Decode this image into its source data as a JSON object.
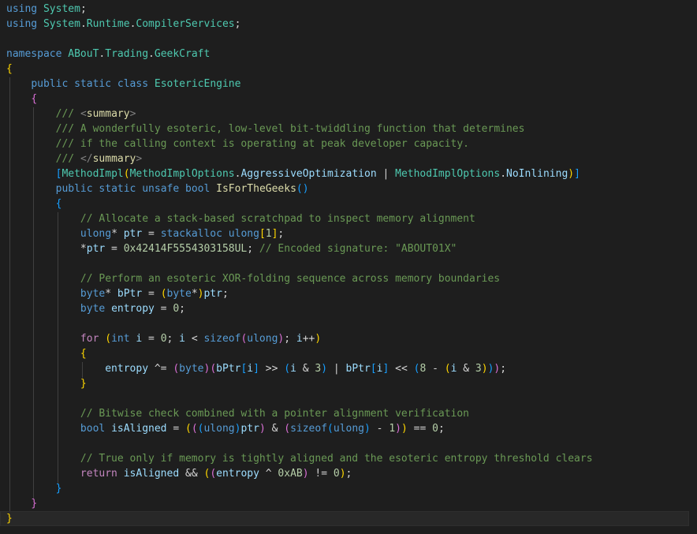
{
  "editor": {
    "language": "csharp",
    "colors": {
      "background": "#1e1e1e",
      "current_line": "#282828",
      "keyword": "#569cd6",
      "control": "#c586c0",
      "type": "#4ec9b0",
      "method": "#dcdcaa",
      "variable": "#9cdcfe",
      "number": "#b5cea8",
      "comment": "#6a9955",
      "bracket_1": "#ffd700",
      "bracket_2": "#da70d6",
      "bracket_3": "#179fff"
    },
    "lines": [
      [
        [
          "keyword",
          "using"
        ],
        [
          "plain",
          " "
        ],
        [
          "type",
          "System"
        ],
        [
          "plain",
          ";"
        ]
      ],
      [
        [
          "keyword",
          "using"
        ],
        [
          "plain",
          " "
        ],
        [
          "type",
          "System"
        ],
        [
          "plain",
          "."
        ],
        [
          "type",
          "Runtime"
        ],
        [
          "plain",
          "."
        ],
        [
          "type",
          "CompilerServices"
        ],
        [
          "plain",
          ";"
        ]
      ],
      [],
      [
        [
          "keyword",
          "namespace"
        ],
        [
          "plain",
          " "
        ],
        [
          "type",
          "ABouT"
        ],
        [
          "plain",
          "."
        ],
        [
          "type",
          "Trading"
        ],
        [
          "plain",
          "."
        ],
        [
          "type",
          "GeekCraft"
        ]
      ],
      [
        [
          "brk1",
          "{"
        ]
      ],
      [
        [
          "plain",
          "    "
        ],
        [
          "keyword",
          "public"
        ],
        [
          "plain",
          " "
        ],
        [
          "keyword",
          "static"
        ],
        [
          "plain",
          " "
        ],
        [
          "keyword",
          "class"
        ],
        [
          "plain",
          " "
        ],
        [
          "type",
          "EsotericEngine"
        ]
      ],
      [
        [
          "plain",
          "    "
        ],
        [
          "brk2",
          "{"
        ]
      ],
      [
        [
          "plain",
          "        "
        ],
        [
          "docc",
          "/// "
        ],
        [
          "doctag",
          "<"
        ],
        [
          "method",
          "summary"
        ],
        [
          "doctag",
          ">"
        ]
      ],
      [
        [
          "plain",
          "        "
        ],
        [
          "docc",
          "/// A wonderfully esoteric, low-level bit-twiddling function that determines"
        ]
      ],
      [
        [
          "plain",
          "        "
        ],
        [
          "docc",
          "/// if the calling context is operating at peak developer capacity."
        ]
      ],
      [
        [
          "plain",
          "        "
        ],
        [
          "docc",
          "/// "
        ],
        [
          "doctag",
          "</"
        ],
        [
          "method",
          "summary"
        ],
        [
          "doctag",
          ">"
        ]
      ],
      [
        [
          "plain",
          "        "
        ],
        [
          "brk3",
          "["
        ],
        [
          "attr",
          "MethodImpl"
        ],
        [
          "brk1",
          "("
        ],
        [
          "type",
          "MethodImplOptions"
        ],
        [
          "plain",
          "."
        ],
        [
          "variable",
          "AggressiveOptimization"
        ],
        [
          "plain",
          " | "
        ],
        [
          "type",
          "MethodImplOptions"
        ],
        [
          "plain",
          "."
        ],
        [
          "variable",
          "NoInlining"
        ],
        [
          "brk1",
          ")"
        ],
        [
          "brk3",
          "]"
        ]
      ],
      [
        [
          "plain",
          "        "
        ],
        [
          "keyword",
          "public"
        ],
        [
          "plain",
          " "
        ],
        [
          "keyword",
          "static"
        ],
        [
          "plain",
          " "
        ],
        [
          "keyword",
          "unsafe"
        ],
        [
          "plain",
          " "
        ],
        [
          "keyword",
          "bool"
        ],
        [
          "plain",
          " "
        ],
        [
          "method",
          "IsForTheGeeks"
        ],
        [
          "brk3",
          "()"
        ]
      ],
      [
        [
          "plain",
          "        "
        ],
        [
          "brk3",
          "{"
        ]
      ],
      [
        [
          "plain",
          "            "
        ],
        [
          "comment",
          "// Allocate a stack-based scratchpad to inspect memory alignment"
        ]
      ],
      [
        [
          "plain",
          "            "
        ],
        [
          "keyword",
          "ulong"
        ],
        [
          "plain",
          "* "
        ],
        [
          "variable",
          "ptr"
        ],
        [
          "plain",
          " = "
        ],
        [
          "keyword",
          "stackalloc"
        ],
        [
          "plain",
          " "
        ],
        [
          "keyword",
          "ulong"
        ],
        [
          "brk1",
          "["
        ],
        [
          "number",
          "1"
        ],
        [
          "brk1",
          "]"
        ],
        [
          "plain",
          ";"
        ]
      ],
      [
        [
          "plain",
          "            "
        ],
        [
          "plain",
          "*"
        ],
        [
          "variable",
          "ptr"
        ],
        [
          "plain",
          " = "
        ],
        [
          "number",
          "0x42414F5554303158UL"
        ],
        [
          "plain",
          "; "
        ],
        [
          "comment",
          "// Encoded signature: \"ABOUT01X\""
        ]
      ],
      [],
      [
        [
          "plain",
          "            "
        ],
        [
          "comment",
          "// Perform an esoteric XOR-folding sequence across memory boundaries"
        ]
      ],
      [
        [
          "plain",
          "            "
        ],
        [
          "keyword",
          "byte"
        ],
        [
          "plain",
          "* "
        ],
        [
          "variable",
          "bPtr"
        ],
        [
          "plain",
          " = "
        ],
        [
          "brk1",
          "("
        ],
        [
          "keyword",
          "byte"
        ],
        [
          "plain",
          "*"
        ],
        [
          "brk1",
          ")"
        ],
        [
          "variable",
          "ptr"
        ],
        [
          "plain",
          ";"
        ]
      ],
      [
        [
          "plain",
          "            "
        ],
        [
          "keyword",
          "byte"
        ],
        [
          "plain",
          " "
        ],
        [
          "variable",
          "entropy"
        ],
        [
          "plain",
          " = "
        ],
        [
          "number",
          "0"
        ],
        [
          "plain",
          ";"
        ]
      ],
      [],
      [
        [
          "plain",
          "            "
        ],
        [
          "control",
          "for"
        ],
        [
          "plain",
          " "
        ],
        [
          "brk1",
          "("
        ],
        [
          "keyword",
          "int"
        ],
        [
          "plain",
          " "
        ],
        [
          "variable",
          "i"
        ],
        [
          "plain",
          " = "
        ],
        [
          "number",
          "0"
        ],
        [
          "plain",
          "; "
        ],
        [
          "variable",
          "i"
        ],
        [
          "plain",
          " < "
        ],
        [
          "keyword",
          "sizeof"
        ],
        [
          "brk2",
          "("
        ],
        [
          "keyword",
          "ulong"
        ],
        [
          "brk2",
          ")"
        ],
        [
          "plain",
          "; "
        ],
        [
          "variable",
          "i"
        ],
        [
          "plain",
          "++"
        ],
        [
          "brk1",
          ")"
        ]
      ],
      [
        [
          "plain",
          "            "
        ],
        [
          "brk1",
          "{"
        ]
      ],
      [
        [
          "plain",
          "                "
        ],
        [
          "variable",
          "entropy"
        ],
        [
          "plain",
          " ^= "
        ],
        [
          "brk2",
          "("
        ],
        [
          "keyword",
          "byte"
        ],
        [
          "brk2",
          ")"
        ],
        [
          "brk2",
          "("
        ],
        [
          "variable",
          "bPtr"
        ],
        [
          "brk3",
          "["
        ],
        [
          "variable",
          "i"
        ],
        [
          "brk3",
          "]"
        ],
        [
          "plain",
          " >> "
        ],
        [
          "brk3",
          "("
        ],
        [
          "variable",
          "i"
        ],
        [
          "plain",
          " & "
        ],
        [
          "number",
          "3"
        ],
        [
          "brk3",
          ")"
        ],
        [
          "plain",
          " | "
        ],
        [
          "variable",
          "bPtr"
        ],
        [
          "brk3",
          "["
        ],
        [
          "variable",
          "i"
        ],
        [
          "brk3",
          "]"
        ],
        [
          "plain",
          " << "
        ],
        [
          "brk3",
          "("
        ],
        [
          "number",
          "8"
        ],
        [
          "plain",
          " - "
        ],
        [
          "brk1",
          "("
        ],
        [
          "variable",
          "i"
        ],
        [
          "plain",
          " & "
        ],
        [
          "number",
          "3"
        ],
        [
          "brk1",
          ")"
        ],
        [
          "brk3",
          ")"
        ],
        [
          "brk2",
          ")"
        ],
        [
          "plain",
          ";"
        ]
      ],
      [
        [
          "plain",
          "            "
        ],
        [
          "brk1",
          "}"
        ]
      ],
      [],
      [
        [
          "plain",
          "            "
        ],
        [
          "comment",
          "// Bitwise check combined with a pointer alignment verification"
        ]
      ],
      [
        [
          "plain",
          "            "
        ],
        [
          "keyword",
          "bool"
        ],
        [
          "plain",
          " "
        ],
        [
          "variable",
          "isAligned"
        ],
        [
          "plain",
          " = "
        ],
        [
          "brk1",
          "("
        ],
        [
          "brk2",
          "("
        ],
        [
          "brk3",
          "("
        ],
        [
          "keyword",
          "ulong"
        ],
        [
          "brk3",
          ")"
        ],
        [
          "variable",
          "ptr"
        ],
        [
          "brk2",
          ")"
        ],
        [
          "plain",
          " & "
        ],
        [
          "brk2",
          "("
        ],
        [
          "keyword",
          "sizeof"
        ],
        [
          "brk3",
          "("
        ],
        [
          "keyword",
          "ulong"
        ],
        [
          "brk3",
          ")"
        ],
        [
          "plain",
          " - "
        ],
        [
          "number",
          "1"
        ],
        [
          "brk2",
          ")"
        ],
        [
          "brk1",
          ")"
        ],
        [
          "plain",
          " == "
        ],
        [
          "number",
          "0"
        ],
        [
          "plain",
          ";"
        ]
      ],
      [],
      [
        [
          "plain",
          "            "
        ],
        [
          "comment",
          "// True only if memory is tightly aligned and the esoteric entropy threshold clears"
        ]
      ],
      [
        [
          "plain",
          "            "
        ],
        [
          "control",
          "return"
        ],
        [
          "plain",
          " "
        ],
        [
          "variable",
          "isAligned"
        ],
        [
          "plain",
          " && "
        ],
        [
          "brk1",
          "("
        ],
        [
          "brk2",
          "("
        ],
        [
          "variable",
          "entropy"
        ],
        [
          "plain",
          " ^ "
        ],
        [
          "number",
          "0xAB"
        ],
        [
          "brk2",
          ")"
        ],
        [
          "plain",
          " != "
        ],
        [
          "number",
          "0"
        ],
        [
          "brk1",
          ")"
        ],
        [
          "plain",
          ";"
        ]
      ],
      [
        [
          "plain",
          "        "
        ],
        [
          "brk3",
          "}"
        ]
      ],
      [
        [
          "plain",
          "    "
        ],
        [
          "brk2",
          "}"
        ]
      ],
      [
        [
          "brk1",
          "}"
        ]
      ]
    ],
    "current_line_index": 34
  }
}
